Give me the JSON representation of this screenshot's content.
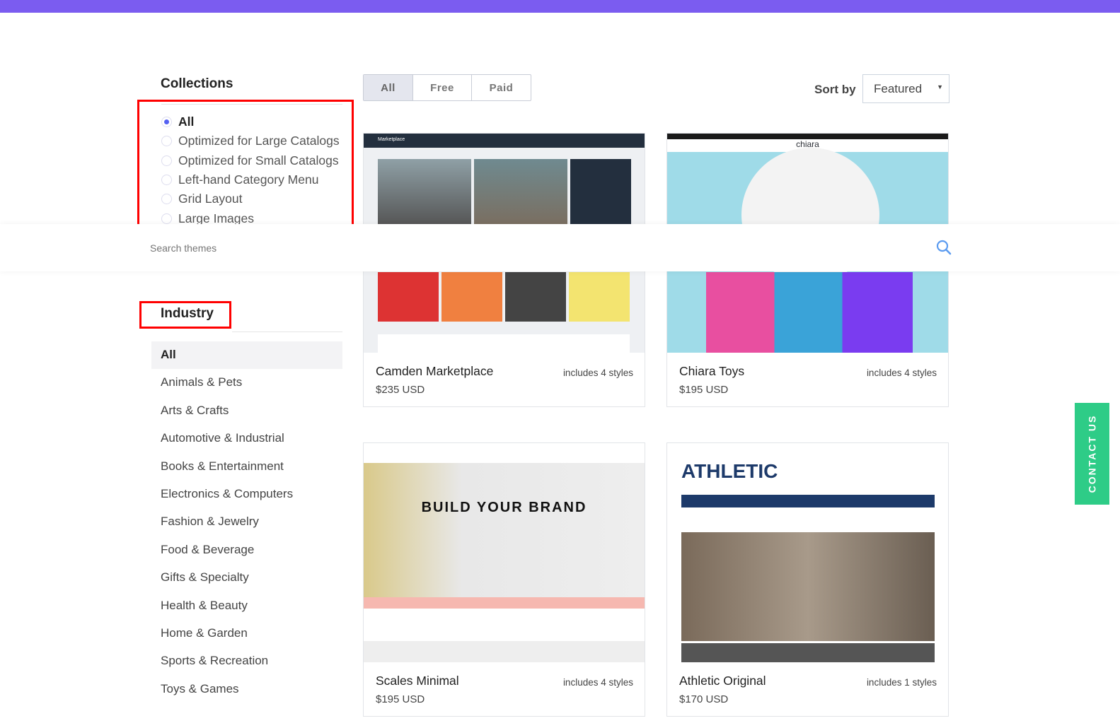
{
  "collections": {
    "title": "Collections",
    "options": [
      {
        "label": "All",
        "selected": true
      },
      {
        "label": "Optimized for Large Catalogs",
        "selected": false
      },
      {
        "label": "Optimized for Small Catalogs",
        "selected": false
      },
      {
        "label": "Left-hand Category Menu",
        "selected": false
      },
      {
        "label": "Grid Layout",
        "selected": false
      },
      {
        "label": "Large Images",
        "selected": false
      }
    ]
  },
  "industry": {
    "title": "Industry",
    "items": [
      "All",
      "Animals & Pets",
      "Arts & Crafts",
      "Automotive & Industrial",
      "Books & Entertainment",
      "Electronics & Computers",
      "Fashion & Jewelry",
      "Food & Beverage",
      "Gifts & Specialty",
      "Health & Beauty",
      "Home & Garden",
      "Sports & Recreation",
      "Toys & Games"
    ]
  },
  "filter": {
    "tabs": [
      "All",
      "Free",
      "Paid"
    ],
    "active": "All"
  },
  "sort": {
    "label": "Sort by",
    "value": "Featured"
  },
  "search": {
    "placeholder": "Search themes"
  },
  "themes": [
    {
      "name": "Camden Marketplace",
      "price": "$235 USD",
      "styles": "includes 4 styles",
      "thumb_text": "Marketplace"
    },
    {
      "name": "Chiara Toys",
      "price": "$195 USD",
      "styles": "includes 4 styles",
      "thumb_text": "chiara"
    },
    {
      "name": "Scales Minimal",
      "price": "$195 USD",
      "styles": "includes 4 styles",
      "thumb_text": "BUILD YOUR BRAND"
    },
    {
      "name": "Athletic Original",
      "price": "$170 USD",
      "styles": "includes 1 styles",
      "thumb_text": "ATHLETIC"
    }
  ],
  "contact": "CONTACT US",
  "colors": {
    "accent": "#5561f2",
    "top": "#7b5cf0",
    "contact": "#2ecc87",
    "highlight": "#ff0000"
  }
}
